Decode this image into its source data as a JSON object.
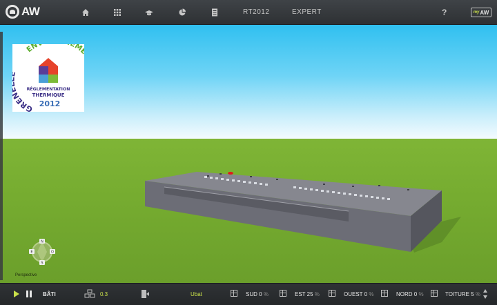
{
  "app": {
    "logo_text": "AW"
  },
  "nav": {
    "rt2012_label": "RT2012",
    "expert_label": "EXPERT",
    "help_label": "?",
    "myaw_my": "my",
    "myaw_aw": "AW"
  },
  "badge": {
    "ring_left": "GRENELLE",
    "ring_right": "ENVIRONNEMENT",
    "line1": "RÉGLEMENTATION",
    "line2": "THERMIQUE",
    "year": "2012"
  },
  "compass": {
    "north": "N",
    "south": "S",
    "east": "E",
    "west": "O",
    "view_label": "Perspective"
  },
  "bottombar": {
    "section_label": "BÂTI",
    "value": "0.3",
    "ubat_label": "Ubat",
    "orientations": [
      {
        "label": "SUD",
        "value": "0",
        "unit": "%"
      },
      {
        "label": "EST",
        "value": "25",
        "unit": "%"
      },
      {
        "label": "OUEST",
        "value": "0",
        "unit": "%"
      },
      {
        "label": "NORD",
        "value": "0",
        "unit": "%"
      },
      {
        "label": "TOITURE",
        "value": "5",
        "unit": "%"
      }
    ]
  },
  "colors": {
    "accent": "#c9e04a",
    "bar": "#2e3134"
  }
}
